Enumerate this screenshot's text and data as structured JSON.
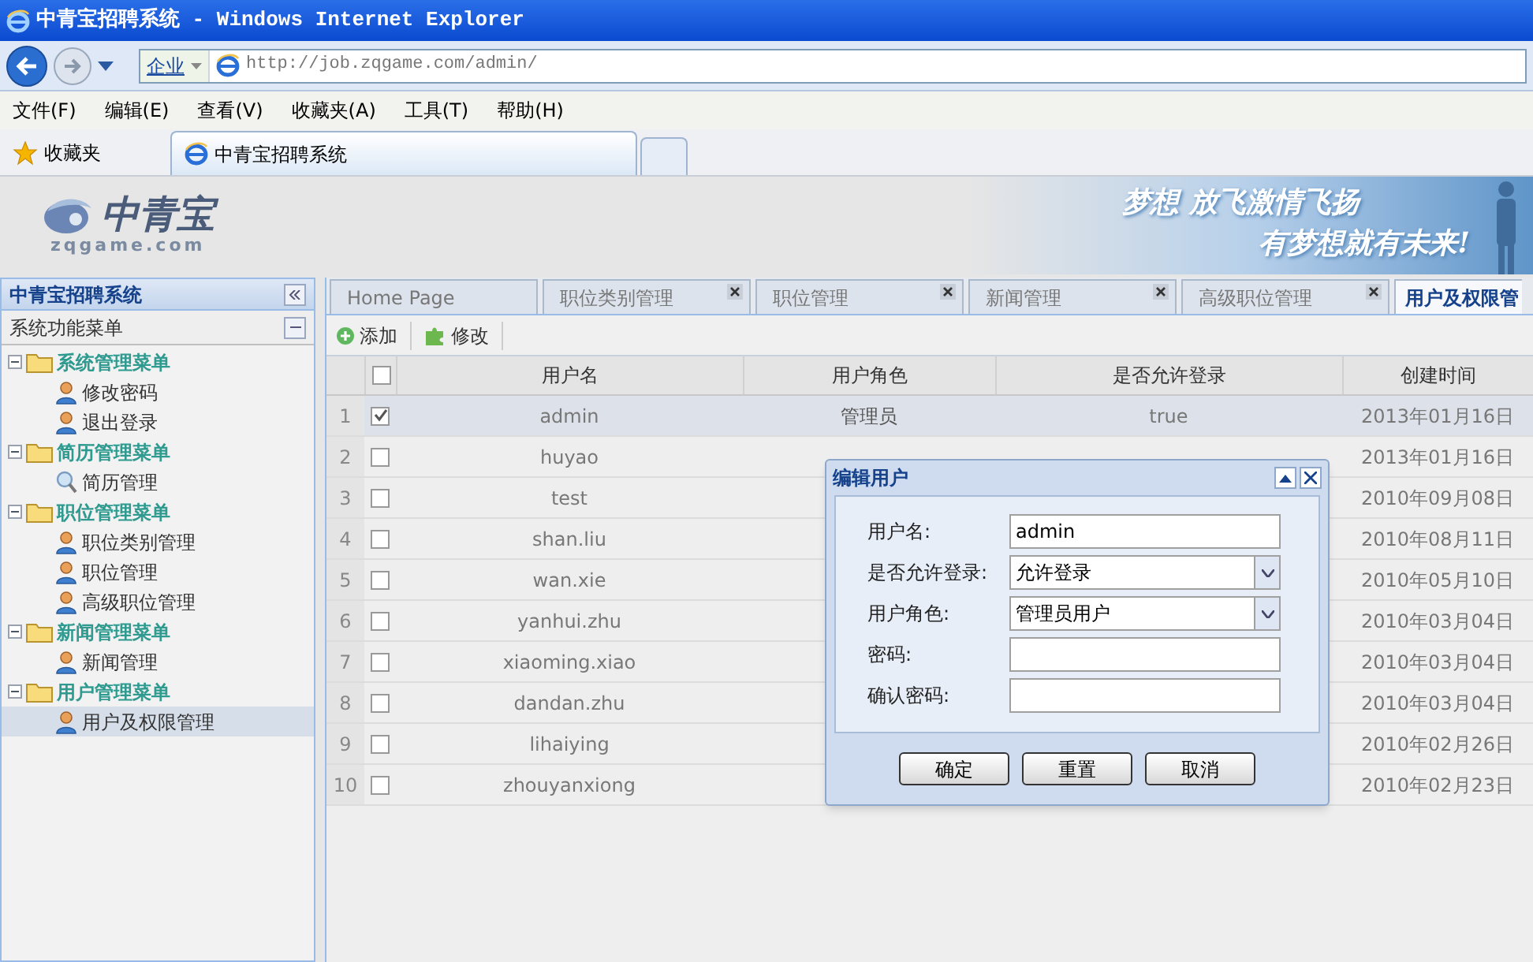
{
  "window": {
    "title": "中青宝招聘系统 - Windows Internet Explorer"
  },
  "address_bar": {
    "zone": "企业",
    "url": "http://job.zqgame.com/admin/"
  },
  "menu_bar": [
    "文件(F)",
    "编辑(E)",
    "查看(V)",
    "收藏夹(A)",
    "工具(T)",
    "帮助(H)"
  ],
  "favorites_bar": {
    "label": "收藏夹",
    "tab": "中青宝招聘系统"
  },
  "header": {
    "logo": "中青宝",
    "logo_sub": "zqgame.com",
    "slogan": [
      "梦想 放飞激情飞扬",
      "有梦想就有未来!"
    ]
  },
  "sidebar": {
    "title": "中青宝招聘系统",
    "subtitle": "系统功能菜单",
    "groups": [
      {
        "label": "系统管理菜单",
        "expanded": true,
        "children": [
          {
            "label": "修改密码",
            "kind": "user",
            "selected": false
          },
          {
            "label": "退出登录",
            "kind": "user",
            "selected": false
          }
        ]
      },
      {
        "label": "简历管理菜单",
        "expanded": true,
        "children": [
          {
            "label": "简历管理",
            "kind": "search",
            "selected": false
          }
        ]
      },
      {
        "label": "职位管理菜单",
        "expanded": true,
        "children": [
          {
            "label": "职位类别管理",
            "kind": "user",
            "selected": false
          },
          {
            "label": "职位管理",
            "kind": "user",
            "selected": false
          },
          {
            "label": "高级职位管理",
            "kind": "user",
            "selected": false
          }
        ]
      },
      {
        "label": "新闻管理菜单",
        "expanded": true,
        "children": [
          {
            "label": "新闻管理",
            "kind": "user",
            "selected": false
          }
        ]
      },
      {
        "label": "用户管理菜单",
        "expanded": true,
        "children": [
          {
            "label": "用户及权限管理",
            "kind": "user",
            "selected": true
          }
        ]
      }
    ]
  },
  "tabs": [
    {
      "label": "Home Page",
      "closable": false,
      "selected": false
    },
    {
      "label": "职位类别管理",
      "closable": true,
      "selected": false
    },
    {
      "label": "职位管理",
      "closable": true,
      "selected": false
    },
    {
      "label": "新闻管理",
      "closable": true,
      "selected": false
    },
    {
      "label": "高级职位管理",
      "closable": true,
      "selected": false
    },
    {
      "label": "用户及权限管",
      "closable": false,
      "selected": true
    }
  ],
  "toolbar": [
    {
      "label": "添加",
      "kind": "add"
    },
    {
      "label": "修改",
      "kind": "edit"
    }
  ],
  "table": {
    "select_all_checked": false,
    "columns": [
      "用户名",
      "用户角色",
      "是否允许登录",
      "创建时间"
    ],
    "rows": [
      {
        "index": "1",
        "checked": true,
        "selected": true,
        "username": "admin",
        "role": "管理员",
        "login": "true",
        "created": "2013年01月16日"
      },
      {
        "index": "2",
        "checked": false,
        "selected": false,
        "username": "huyao",
        "created": "2013年01月16日"
      },
      {
        "index": "3",
        "checked": false,
        "selected": false,
        "username": "test",
        "created": "2010年09月08日"
      },
      {
        "index": "4",
        "checked": false,
        "selected": false,
        "username": "shan.liu",
        "created": "2010年08月11日"
      },
      {
        "index": "5",
        "checked": false,
        "selected": false,
        "username": "wan.xie",
        "created": "2010年05月10日"
      },
      {
        "index": "6",
        "checked": false,
        "selected": false,
        "username": "yanhui.zhu",
        "created": "2010年03月04日"
      },
      {
        "index": "7",
        "checked": false,
        "selected": false,
        "username": "xiaoming.xiao",
        "created": "2010年03月04日"
      },
      {
        "index": "8",
        "checked": false,
        "selected": false,
        "username": "dandan.zhu",
        "created": "2010年03月04日"
      },
      {
        "index": "9",
        "checked": false,
        "selected": false,
        "username": "lihaiying",
        "created": "2010年02月26日"
      },
      {
        "index": "10",
        "checked": false,
        "selected": false,
        "username": "zhouyanxiong",
        "created": "2010年02月23日"
      }
    ]
  },
  "dialog": {
    "title": "编辑用户",
    "fields": [
      {
        "label": "用户名:",
        "kind": "text",
        "value": "admin"
      },
      {
        "label": "是否允许登录:",
        "kind": "select",
        "value": "允许登录"
      },
      {
        "label": "用户角色:",
        "kind": "select",
        "value": "管理员用户"
      },
      {
        "label": "密码:",
        "kind": "text"
      },
      {
        "label": "确认密码:",
        "kind": "text"
      }
    ],
    "buttons": [
      "确定",
      "重置",
      "取消"
    ]
  }
}
